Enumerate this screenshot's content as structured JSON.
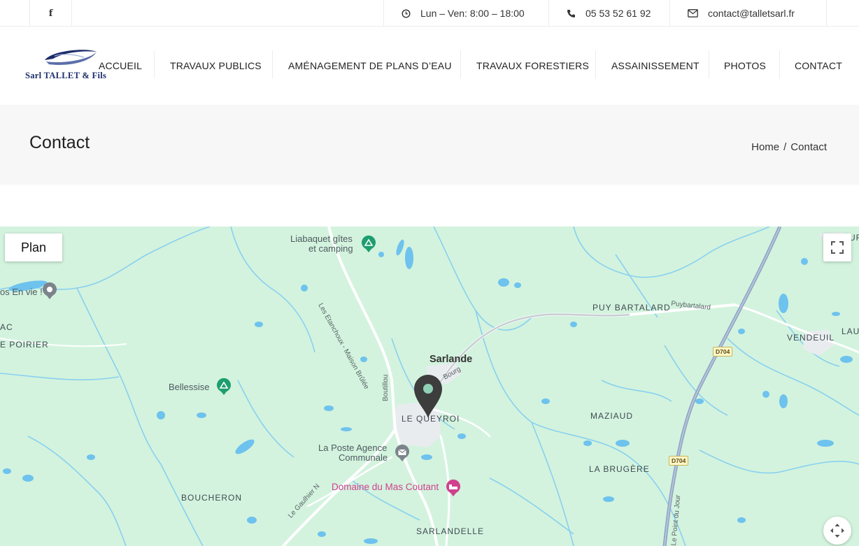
{
  "topbar": {
    "facebook_icon": "facebook-icon",
    "hours": "Lun – Ven: 8:00 – 18:00",
    "hours_icon": "clock-icon",
    "phone": "05 53 52 61 92",
    "phone_icon": "phone-icon",
    "email": "contact@talletsarl.fr",
    "email_icon": "envelope-icon"
  },
  "logo": {
    "text": "Sarl TALLET & Fils"
  },
  "nav": {
    "items": [
      {
        "label": "ACCUEIL"
      },
      {
        "label": "TRAVAUX PUBLICS"
      },
      {
        "label": "AMÉNAGEMENT DE PLANS D’EAU"
      },
      {
        "label": "TRAVAUX FORESTIERS"
      },
      {
        "label": "ASSAINISSEMENT"
      },
      {
        "label": "PHOTOS"
      },
      {
        "label": "CONTACT"
      }
    ]
  },
  "page": {
    "title": "Contact",
    "breadcrumb": {
      "home": "Home",
      "separator": "/",
      "current": "Contact"
    }
  },
  "map": {
    "type_button": "Plan",
    "fullscreen_icon": "fullscreen-icon",
    "pan_icon": "move-arrows-icon",
    "marker_icon": "map-pin-icon",
    "colors": {
      "land": "#d3f3de",
      "water": "#7fc9ee",
      "road": "#ffffff",
      "highway": "#8ea3c2",
      "marker": "#3d3d3d",
      "poi_green": "#1e9e6e",
      "poi_pink": "#d0418d"
    },
    "labels": {
      "liabaquet_1": "Liabaquet gîtes",
      "liabaquet_2": "et camping",
      "en_vie": "os En vie !",
      "ac": "AC",
      "poirier": "E POIRIER",
      "bellessise": "Bellessise",
      "etanchoux": "Les Etanchoux - Maison Brûlée",
      "boutillou": "Boutillou",
      "sarlande": "Sarlande",
      "bourg": "Bourg",
      "le_queyroi": "LE QUEYROI",
      "poste_1": "La Poste Agence",
      "poste_2": "Communale",
      "domaine": "Domaine du Mas Coutant",
      "boucheron": "BOUCHERON",
      "gaulhier": "Le Gaulhier N",
      "sarlandelle": "SARLANDELLE",
      "puy_bartalard": "PUY BARTALARD",
      "puybartalard_road": "Puybartalard",
      "vendeuil": "VENDEUIL",
      "lau": "LAU",
      "maziaud": "MAZIAUD",
      "la_brugere": "LA BRUGÈRE",
      "point_du_jour": "Le Point du Jour",
      "d704_a": "D704",
      "d704_b": "D704",
      "ur": "UR"
    }
  }
}
